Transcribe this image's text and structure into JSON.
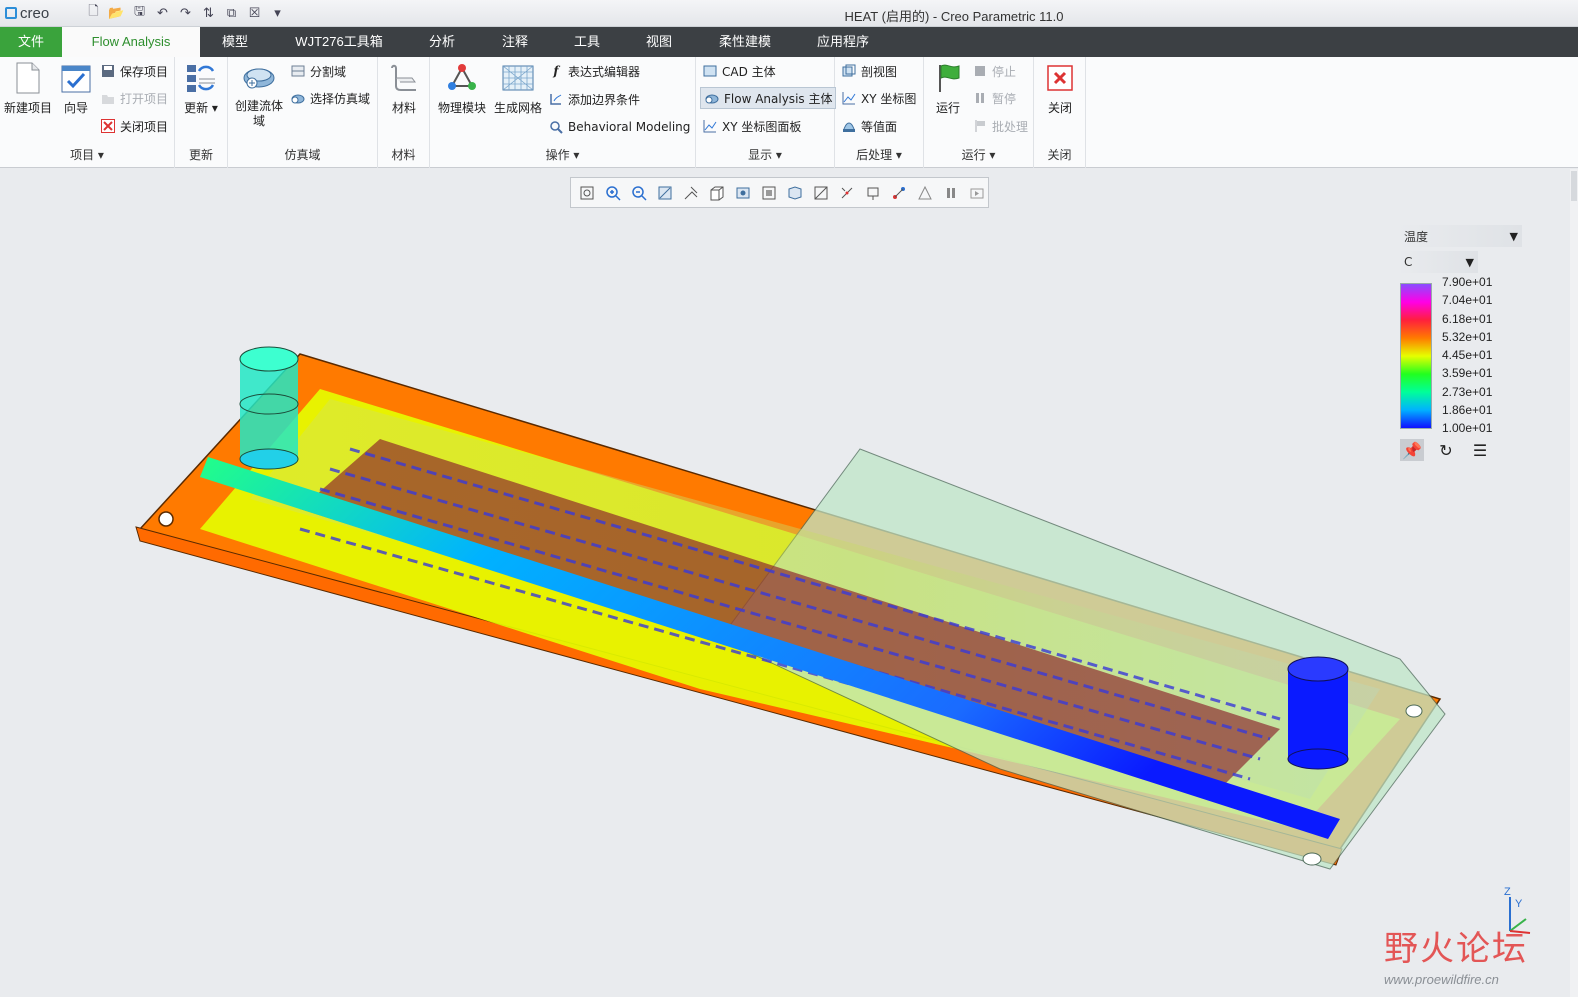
{
  "window": {
    "logo": "creo",
    "title": "HEAT (启用的) - Creo Parametric 11.0"
  },
  "menu": {
    "tabs": [
      "文件",
      "Flow Analysis",
      "模型",
      "WJT276工具箱",
      "分析",
      "注释",
      "工具",
      "视图",
      "柔性建模",
      "应用程序"
    ],
    "active": "Flow Analysis"
  },
  "ribbon": {
    "project": {
      "label": "项目",
      "new": "新建项目",
      "wizard": "向导",
      "save": "保存项目",
      "open": "打开项目",
      "close": "关闭项目"
    },
    "update": {
      "label": "更新",
      "button": "更新"
    },
    "domain": {
      "label": "仿真域",
      "create": "创建流体域",
      "split": "分割域",
      "select": "选择仿真域"
    },
    "material": {
      "label": "材料",
      "button": "材料"
    },
    "operations": {
      "label": "操作",
      "physics": "物理模块",
      "mesh": "生成网格",
      "expr": "表达式编辑器",
      "boundary": "添加边界条件",
      "behavioral": "Behavioral Modeling"
    },
    "display": {
      "label": "显示",
      "cad": "CAD 主体",
      "flow": "Flow Analysis 主体",
      "xypanel": "XY 坐标图面板"
    },
    "post": {
      "label": "后处理",
      "section": "剖视图",
      "xy": "XY 坐标图",
      "iso": "等值面"
    },
    "run": {
      "label": "运行",
      "run": "运行",
      "stop": "停止",
      "pause": "暂停",
      "batch": "批处理"
    },
    "closegrp": {
      "label": "关闭",
      "button": "关闭"
    }
  },
  "legend": {
    "quantity": "温度",
    "unit": "C",
    "ticks": [
      "7.90e+01",
      "7.04e+01",
      "6.18e+01",
      "5.32e+01",
      "4.45e+01",
      "3.59e+01",
      "2.73e+01",
      "1.86e+01",
      "1.00e+01"
    ],
    "colors": [
      "#8a4dff",
      "#ff00e6",
      "#ff1f3d",
      "#ff7a00",
      "#e6ff00",
      "#22ff1f",
      "#00ff99",
      "#00b2ff",
      "#1010ff"
    ]
  },
  "axis": {
    "z": "Z",
    "y": "Y"
  },
  "watermark": {
    "text": "野火论坛",
    "url": "www.proewildfire.cn"
  }
}
